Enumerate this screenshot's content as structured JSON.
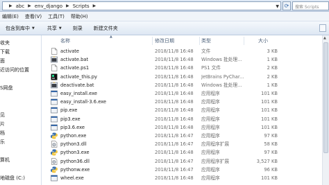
{
  "address": {
    "crumbs": [
      "abc",
      "env_django",
      "Scripts"
    ],
    "search_placeholder": "搜索 Scripts"
  },
  "menu": [
    "编辑(E)",
    "查看(V)",
    "工具(T)",
    "帮助(H)"
  ],
  "toolbar": {
    "include_label": "包含到库中",
    "share_label": "共享",
    "burn_label": "刻录",
    "new_folder_label": "新建文件夹"
  },
  "nav": [
    "收夹",
    "下载",
    "面",
    "近访问的位置",
    "S网盘",
    "",
    "见",
    "片",
    "档",
    "乐",
    "",
    "算机",
    "地磁盘 (C:)"
  ],
  "columns": {
    "name": "名称",
    "date": "修改日期",
    "type": "类型",
    "size": "大小"
  },
  "files": [
    {
      "name": "activate",
      "date": "2018/11/8 16:48",
      "type": "文件",
      "size": "3 KB",
      "icon": "blank-file-icon"
    },
    {
      "name": "activate.bat",
      "date": "2018/11/8 16:48",
      "type": "Windows 批处理...",
      "size": "1 KB",
      "icon": "batch-file-icon"
    },
    {
      "name": "activate.ps1",
      "date": "2018/11/8 16:48",
      "type": "PS1 文件",
      "size": "2 KB",
      "icon": "blank-file-icon"
    },
    {
      "name": "activate_this.py",
      "date": "2018/11/8 16:48",
      "type": "JetBrains PyChar...",
      "size": "2 KB",
      "icon": "pycharm-file-icon"
    },
    {
      "name": "deactivate.bat",
      "date": "2018/11/8 16:48",
      "type": "Windows 批处理...",
      "size": "1 KB",
      "icon": "batch-file-icon"
    },
    {
      "name": "easy_install.exe",
      "date": "2018/11/8 16:48",
      "type": "应用程序",
      "size": "101 KB",
      "icon": "exe-file-icon"
    },
    {
      "name": "easy_install-3.6.exe",
      "date": "2018/11/8 16:48",
      "type": "应用程序",
      "size": "101 KB",
      "icon": "exe-file-icon"
    },
    {
      "name": "pip.exe",
      "date": "2018/11/8 16:48",
      "type": "应用程序",
      "size": "101 KB",
      "icon": "exe-file-icon"
    },
    {
      "name": "pip3.exe",
      "date": "2018/11/8 16:48",
      "type": "应用程序",
      "size": "101 KB",
      "icon": "exe-file-icon"
    },
    {
      "name": "pip3.6.exe",
      "date": "2018/11/8 16:48",
      "type": "应用程序",
      "size": "101 KB",
      "icon": "exe-file-icon"
    },
    {
      "name": "python.exe",
      "date": "2018/11/8 16:47",
      "type": "应用程序",
      "size": "97 KB",
      "icon": "python-exe-icon"
    },
    {
      "name": "python3.dll",
      "date": "2018/11/8 16:47",
      "type": "应用程序扩展",
      "size": "58 KB",
      "icon": "dll-file-icon"
    },
    {
      "name": "python3.exe",
      "date": "2018/11/8 16:48",
      "type": "应用程序",
      "size": "97 KB",
      "icon": "python-exe-icon"
    },
    {
      "name": "python36.dll",
      "date": "2018/11/8 16:47",
      "type": "应用程序扩展",
      "size": "3,527 KB",
      "icon": "dll-file-icon"
    },
    {
      "name": "pythonw.exe",
      "date": "2018/11/8 16:47",
      "type": "应用程序",
      "size": "96 KB",
      "icon": "python-exe-icon"
    },
    {
      "name": "wheel.exe",
      "date": "2018/11/8 16:48",
      "type": "应用程序",
      "size": "101 KB",
      "icon": "exe-file-icon"
    }
  ],
  "colors": {
    "accent": "#3567a8",
    "python_blue": "#3c72b0",
    "python_yellow": "#f3c845"
  }
}
